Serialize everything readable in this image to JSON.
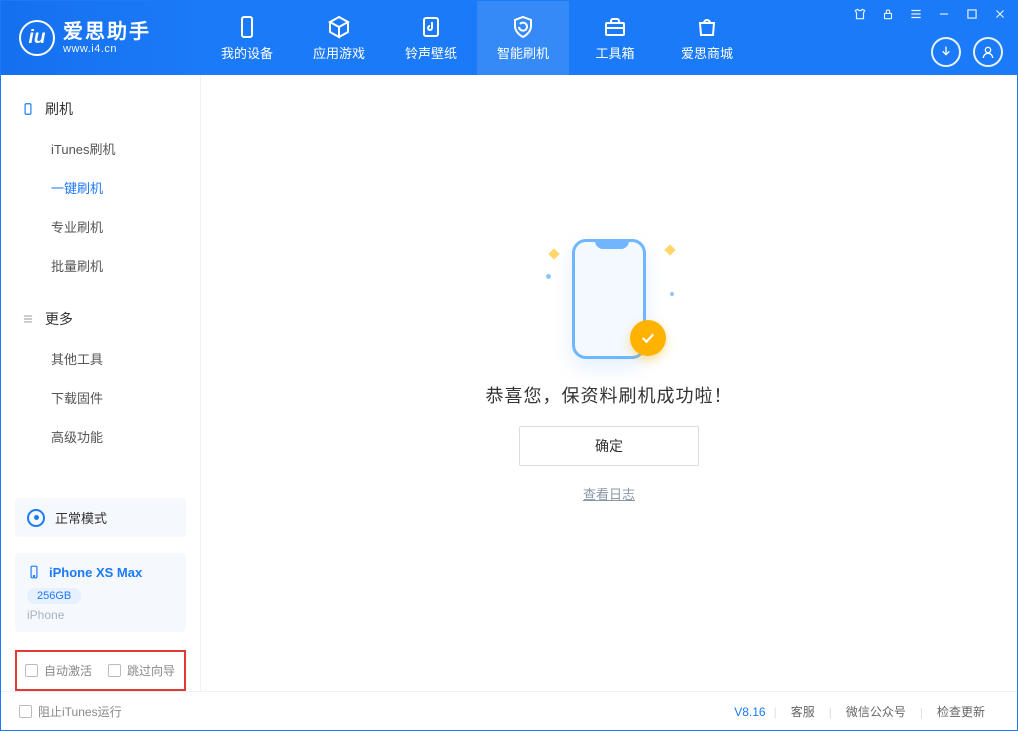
{
  "app": {
    "name": "爱思助手",
    "url": "www.i4.cn"
  },
  "tabs": [
    {
      "label": "我的设备"
    },
    {
      "label": "应用游戏"
    },
    {
      "label": "铃声壁纸"
    },
    {
      "label": "智能刷机",
      "active": true
    },
    {
      "label": "工具箱"
    },
    {
      "label": "爱思商城"
    }
  ],
  "sidebar": {
    "section1": "刷机",
    "items1": [
      "iTunes刷机",
      "一键刷机",
      "专业刷机",
      "批量刷机"
    ],
    "active1": 1,
    "section2": "更多",
    "items2": [
      "其他工具",
      "下载固件",
      "高级功能"
    ]
  },
  "mode": {
    "label": "正常模式"
  },
  "device": {
    "name": "iPhone XS Max",
    "capacity": "256GB",
    "type": "iPhone"
  },
  "options": {
    "auto_activate": "自动激活",
    "skip_guide": "跳过向导"
  },
  "main": {
    "success_msg": "恭喜您，保资料刷机成功啦！",
    "ok": "确定",
    "view_log": "查看日志"
  },
  "footer": {
    "block_itunes": "阻止iTunes运行",
    "version": "V8.16",
    "links": [
      "客服",
      "微信公众号",
      "检查更新"
    ]
  }
}
